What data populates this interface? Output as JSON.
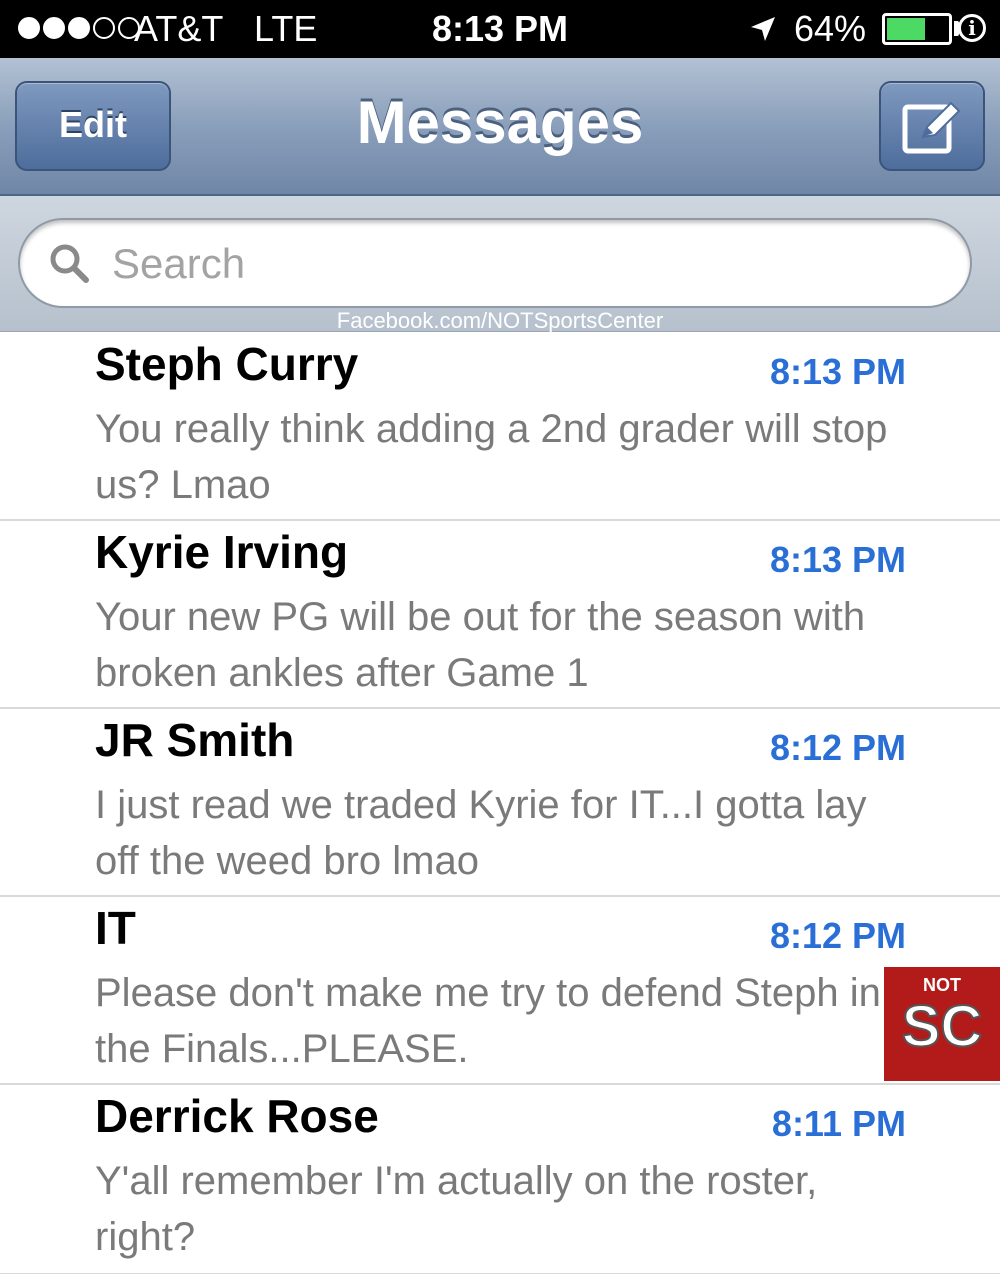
{
  "status_bar": {
    "carrier": "AT&T",
    "network": "LTE",
    "time": "8:13 PM",
    "battery_percent": "64%",
    "battery_level": 0.64,
    "signal_bars_filled": 3,
    "signal_bars_total": 5
  },
  "nav": {
    "edit_label": "Edit",
    "title": "Messages",
    "compose_icon": "compose-icon"
  },
  "search": {
    "placeholder": "Search"
  },
  "watermark": "Facebook.com/NOTSportsCenter",
  "messages": [
    {
      "contact": "Steph Curry",
      "time": "8:13 PM",
      "preview": "You really think adding a 2nd grader will stop us? Lmao"
    },
    {
      "contact": "Kyrie Irving",
      "time": "8:13 PM",
      "preview": "Your new PG will be out for the season with broken ankles after Game 1"
    },
    {
      "contact": "JR Smith",
      "time": "8:12 PM",
      "preview": "I just read we traded Kyrie for IT...I gotta lay off the weed bro lmao"
    },
    {
      "contact": "IT",
      "time": "8:12 PM",
      "preview": "Please don't make me try to defend Steph in the Finals...PLEASE."
    },
    {
      "contact": "Derrick Rose",
      "time": "8:11 PM",
      "preview": "Y'all remember I'm actually on the roster, right?"
    }
  ],
  "logo": {
    "top": "NOT",
    "main": "SC"
  },
  "colors": {
    "time_blue": "#2a6fd6",
    "nav_blue": "#8a9fbb",
    "battery_green": "#4cd964",
    "logo_red": "#b31b1b"
  }
}
